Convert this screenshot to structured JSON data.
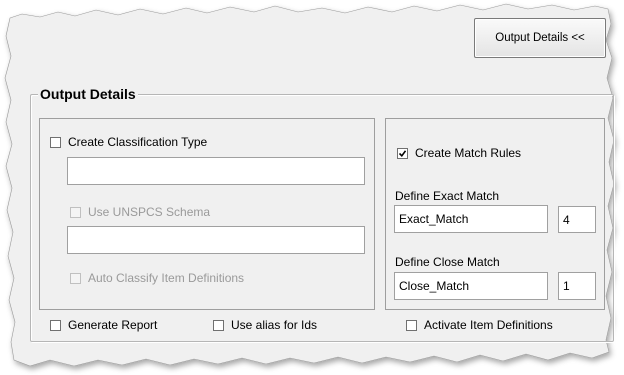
{
  "toggle_button_label": "Output Details <<",
  "group_title": "Output Details",
  "classification": {
    "checkbox_label": "Create Classification Type",
    "checked": false,
    "name_value": "",
    "use_unspcs_label": "Use UNSPCS Schema",
    "schema_value": "",
    "auto_classify_label": "Auto Classify Item Definitions"
  },
  "match_rules": {
    "checkbox_label": "Create Match Rules",
    "checked": true,
    "exact_label": "Define Exact Match",
    "exact_value": "Exact_Match",
    "exact_count": "4",
    "close_label": "Define Close Match",
    "close_value": "Close_Match",
    "close_count": "1"
  },
  "footer": {
    "generate_report_label": "Generate Report",
    "use_alias_label": "Use alias for Ids",
    "activate_items_label": "Activate Item Definitions"
  },
  "colors": {
    "dialog_bg": "#f0f0f0",
    "disabled_text": "#9a9a9a",
    "frame_border": "#b6b6b6"
  }
}
